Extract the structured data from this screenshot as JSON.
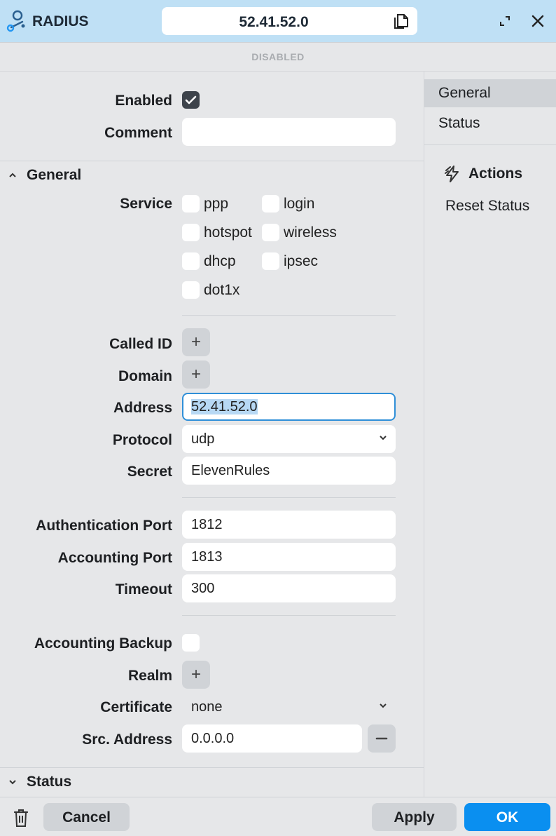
{
  "header": {
    "app_title": "RADIUS",
    "address": "52.41.52.0",
    "state": "DISABLED"
  },
  "form": {
    "enabled_label": "Enabled",
    "enabled": true,
    "comment_label": "Comment",
    "comment_value": "",
    "general_title": "General",
    "service_label": "Service",
    "services": [
      {
        "label": "ppp",
        "checked": false
      },
      {
        "label": "login",
        "checked": false
      },
      {
        "label": "hotspot",
        "checked": false
      },
      {
        "label": "wireless",
        "checked": false
      },
      {
        "label": "dhcp",
        "checked": false
      },
      {
        "label": "ipsec",
        "checked": false
      },
      {
        "label": "dot1x",
        "checked": false
      }
    ],
    "called_id_label": "Called ID",
    "domain_label": "Domain",
    "address_label": "Address",
    "address_value": "52.41.52.0",
    "protocol_label": "Protocol",
    "protocol_value": "udp",
    "secret_label": "Secret",
    "secret_value": "ElevenRules",
    "auth_port_label": "Authentication Port",
    "auth_port_value": "1812",
    "acct_port_label": "Accounting Port",
    "acct_port_value": "1813",
    "timeout_label": "Timeout",
    "timeout_value": "300",
    "acct_backup_label": "Accounting Backup",
    "acct_backup": false,
    "realm_label": "Realm",
    "certificate_label": "Certificate",
    "certificate_value": "none",
    "src_address_label": "Src. Address",
    "src_address_value": "0.0.0.0",
    "status_title": "Status",
    "plus": "+"
  },
  "sidebar": {
    "items": [
      "General",
      "Status"
    ],
    "active": "General",
    "actions_title": "Actions",
    "reset_status": "Reset Status"
  },
  "footer": {
    "cancel": "Cancel",
    "apply": "Apply",
    "ok": "OK"
  },
  "colors": {
    "header_bg": "#bfe0f5",
    "accent": "#0a8ff0",
    "focus_border": "#2f8fd8"
  }
}
